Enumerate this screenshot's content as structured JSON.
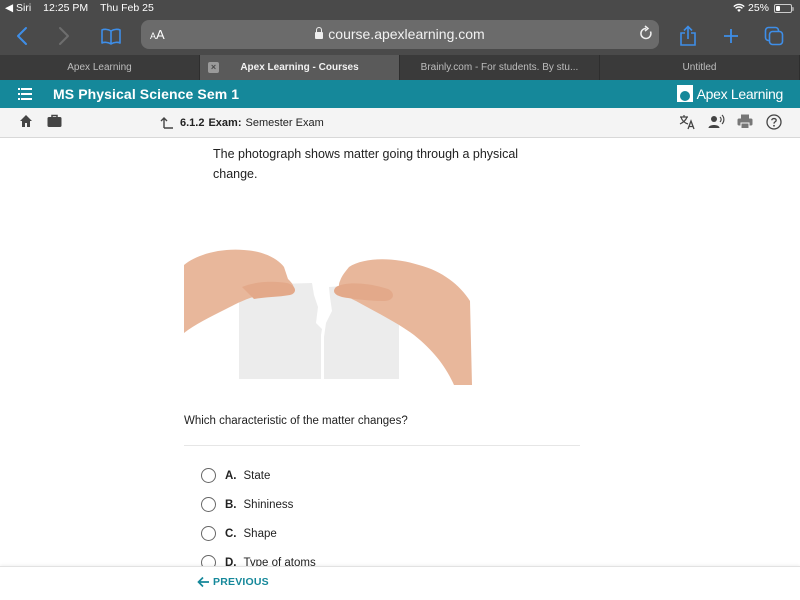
{
  "status_bar": {
    "back_app": "◀ Siri",
    "time": "12:25 PM",
    "date": "Thu Feb 25",
    "battery_percent_label": "25%",
    "battery_level": 0.25
  },
  "browser": {
    "text_size_label_small": "A",
    "text_size_label_large": "A",
    "url": "course.apexlearning.com",
    "tabs": [
      {
        "label": "Apex Learning",
        "active": false
      },
      {
        "label": "Apex Learning - Courses",
        "active": true
      },
      {
        "label": "Brainly.com - For students. By stu...",
        "active": false
      },
      {
        "label": "Untitled",
        "active": false
      }
    ]
  },
  "app_bar": {
    "course_title": "MS Physical Science Sem 1",
    "brand": "Apex Learning"
  },
  "sub_bar": {
    "section_number": "6.1.2",
    "section_type": "Exam:",
    "section_title": "Semester Exam"
  },
  "question": {
    "prompt": "The photograph shows matter going through a physical change.",
    "image_alt": "Two hands tearing a sheet of white paper",
    "question_text": "Which characteristic of the matter changes?",
    "options": [
      {
        "letter": "A.",
        "text": "State"
      },
      {
        "letter": "B.",
        "text": "Shininess"
      },
      {
        "letter": "C.",
        "text": "Shape"
      },
      {
        "letter": "D.",
        "text": "Type of atoms"
      }
    ]
  },
  "footer": {
    "previous_label": "PREVIOUS"
  },
  "colors": {
    "brand_teal": "#15889a",
    "safari_blue": "#3e8ee8"
  }
}
